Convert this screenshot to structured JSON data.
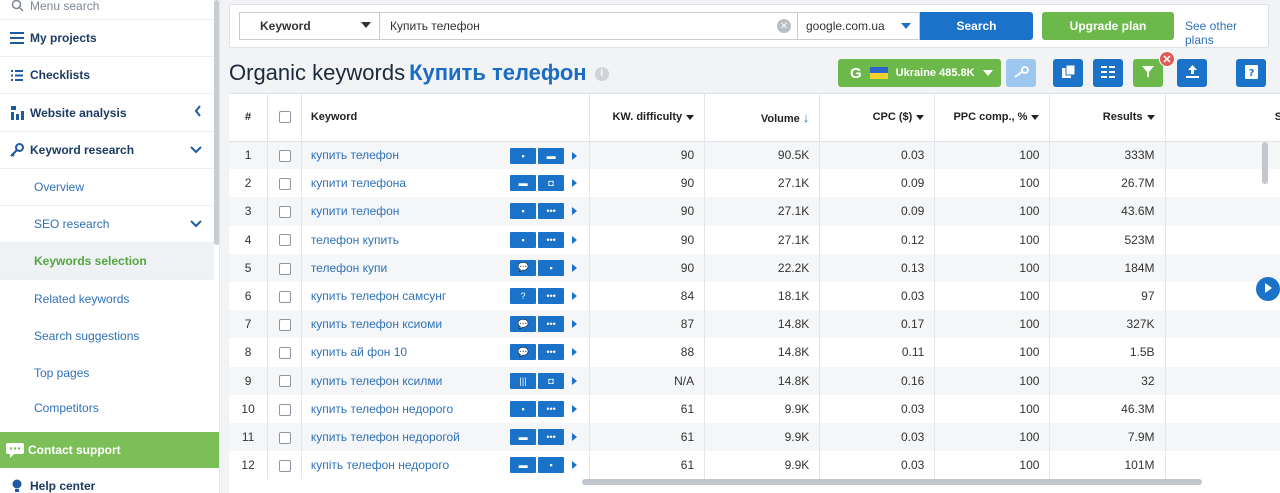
{
  "sidebar": {
    "search_placeholder": "Menu search",
    "items": [
      {
        "label": "My projects"
      },
      {
        "label": "Checklists"
      },
      {
        "label": "Website analysis"
      },
      {
        "label": "Keyword research"
      }
    ],
    "sub_items": [
      {
        "label": "Overview"
      },
      {
        "label": "SEO research"
      },
      {
        "label": "Keywords selection"
      },
      {
        "label": "Related keywords"
      },
      {
        "label": "Search suggestions"
      },
      {
        "label": "Top pages"
      },
      {
        "label": "Competitors"
      }
    ],
    "contact_support": "Contact support",
    "help_center": "Help center"
  },
  "search": {
    "mode": "Keyword",
    "query": "Купить телефон",
    "engine": "google.com.ua",
    "search_label": "Search",
    "upgrade_label": "Upgrade plan",
    "see_other": "See other plans"
  },
  "page": {
    "title_prefix": "Organic keywords",
    "title_keyword": "Купить телефон",
    "database_letter": "G",
    "database_label": "Ukraine 485.8K"
  },
  "table": {
    "headers": {
      "num": "#",
      "keyword": "Keyword",
      "kd": "KW. difficulty",
      "volume": "Volume",
      "cpc": "CPC ($)",
      "ppc": "PPC comp., %",
      "results": "Results",
      "social": "Soci"
    },
    "rows": [
      {
        "n": "1",
        "kw": "купить телефон",
        "kd": "90",
        "vol": "90.5K",
        "cpc": "0.03",
        "ppc": "100",
        "res": "333M"
      },
      {
        "n": "2",
        "kw": "купити телефона",
        "kd": "90",
        "vol": "27.1K",
        "cpc": "0.09",
        "ppc": "100",
        "res": "26.7M"
      },
      {
        "n": "3",
        "kw": "купити телефон",
        "kd": "90",
        "vol": "27.1K",
        "cpc": "0.09",
        "ppc": "100",
        "res": "43.6M"
      },
      {
        "n": "4",
        "kw": "телефон купить",
        "kd": "90",
        "vol": "27.1K",
        "cpc": "0.12",
        "ppc": "100",
        "res": "523M"
      },
      {
        "n": "5",
        "kw": "телефон купи",
        "kd": "90",
        "vol": "22.2K",
        "cpc": "0.13",
        "ppc": "100",
        "res": "184M"
      },
      {
        "n": "6",
        "kw": "купить телефон самсунг",
        "kd": "84",
        "vol": "18.1K",
        "cpc": "0.03",
        "ppc": "100",
        "res": "97"
      },
      {
        "n": "7",
        "kw": "купить телефон ксиоми",
        "kd": "87",
        "vol": "14.8K",
        "cpc": "0.17",
        "ppc": "100",
        "res": "327K"
      },
      {
        "n": "8",
        "kw": "купить ай фон 10",
        "kd": "88",
        "vol": "14.8K",
        "cpc": "0.11",
        "ppc": "100",
        "res": "1.5B"
      },
      {
        "n": "9",
        "kw": "купить телефон ксилми",
        "kd": "N/A",
        "vol": "14.8K",
        "cpc": "0.16",
        "ppc": "100",
        "res": "32"
      },
      {
        "n": "10",
        "kw": "купить телефон недорого",
        "kd": "61",
        "vol": "9.9K",
        "cpc": "0.03",
        "ppc": "100",
        "res": "46.3M"
      },
      {
        "n": "11",
        "kw": "купить телефон недорогой",
        "kd": "61",
        "vol": "9.9K",
        "cpc": "0.03",
        "ppc": "100",
        "res": "7.9M"
      },
      {
        "n": "12",
        "kw": "купіть телефон недорого",
        "kd": "61",
        "vol": "9.9K",
        "cpc": "0.03",
        "ppc": "100",
        "res": "101M"
      }
    ]
  },
  "colors": {
    "accent_blue": "#1a73c9",
    "accent_green": "#6cb84a",
    "active_green": "#53a53e"
  }
}
